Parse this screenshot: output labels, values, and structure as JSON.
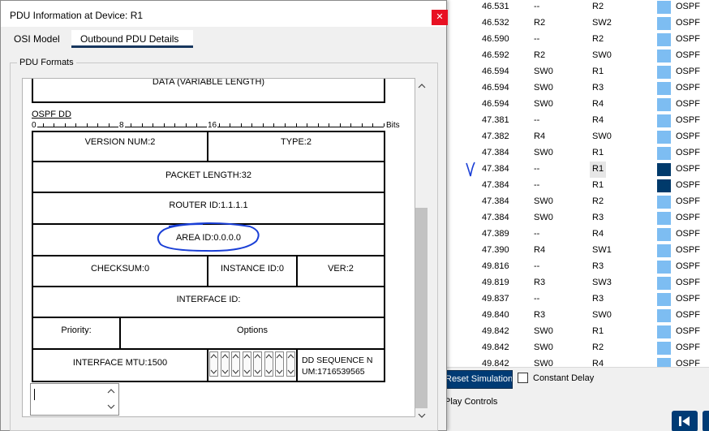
{
  "window": {
    "title": "PDU Information at Device: R1",
    "close_glyph": "✕"
  },
  "tabs": [
    {
      "label": "OSI Model"
    },
    {
      "label": "Outbound PDU Details"
    }
  ],
  "pdu_formats_label": "PDU Formats",
  "diagram": {
    "top_field": "DATA (VARIABLE LENGTH)",
    "ruler": {
      "title": "OSPF DD",
      "marks": [
        "0",
        "8",
        "16"
      ],
      "unit": "Bits"
    },
    "fields": {
      "version": "VERSION NUM:2",
      "type": "TYPE:2",
      "packet_length": "PACKET LENGTH:32",
      "router_id": "ROUTER ID:1.1.1.1",
      "area_id": "AREA ID:0.0.0.0",
      "checksum": "CHECKSUM:0",
      "instance_id": "INSTANCE ID:0",
      "ver": "VER:2",
      "interface_id": "INTERFACE ID:",
      "priority": "Priority:",
      "options": "Options",
      "interface_mtu": "INTERFACE MTU:1500",
      "dd_sequence_line1": "DD SEQUENCE N",
      "dd_sequence_line2": "UM:1716539565"
    }
  },
  "events": [
    {
      "time": "46.531",
      "last": "--",
      "at": "R2",
      "color": "#7dbdf2",
      "type": "OSPF"
    },
    {
      "time": "46.532",
      "last": "R2",
      "at": "SW2",
      "color": "#7dbdf2",
      "type": "OSPF"
    },
    {
      "time": "46.590",
      "last": "--",
      "at": "R2",
      "color": "#7dbdf2",
      "type": "OSPF"
    },
    {
      "time": "46.592",
      "last": "R2",
      "at": "SW0",
      "color": "#7dbdf2",
      "type": "OSPF"
    },
    {
      "time": "46.594",
      "last": "SW0",
      "at": "R1",
      "color": "#7dbdf2",
      "type": "OSPF"
    },
    {
      "time": "46.594",
      "last": "SW0",
      "at": "R3",
      "color": "#7dbdf2",
      "type": "OSPF"
    },
    {
      "time": "46.594",
      "last": "SW0",
      "at": "R4",
      "color": "#7dbdf2",
      "type": "OSPF"
    },
    {
      "time": "47.381",
      "last": "--",
      "at": "R4",
      "color": "#7dbdf2",
      "type": "OSPF"
    },
    {
      "time": "47.382",
      "last": "R4",
      "at": "SW0",
      "color": "#7dbdf2",
      "type": "OSPF"
    },
    {
      "time": "47.384",
      "last": "SW0",
      "at": "R1",
      "color": "#7dbdf2",
      "type": "OSPF"
    },
    {
      "time": "47.384",
      "last": "--",
      "at": "R1",
      "color": "#003a6b",
      "type": "OSPF",
      "selected": true
    },
    {
      "time": "47.384",
      "last": "--",
      "at": "R1",
      "color": "#003a6b",
      "type": "OSPF"
    },
    {
      "time": "47.384",
      "last": "SW0",
      "at": "R2",
      "color": "#7dbdf2",
      "type": "OSPF"
    },
    {
      "time": "47.384",
      "last": "SW0",
      "at": "R3",
      "color": "#7dbdf2",
      "type": "OSPF"
    },
    {
      "time": "47.389",
      "last": "--",
      "at": "R4",
      "color": "#7dbdf2",
      "type": "OSPF"
    },
    {
      "time": "47.390",
      "last": "R4",
      "at": "SW1",
      "color": "#7dbdf2",
      "type": "OSPF"
    },
    {
      "time": "49.816",
      "last": "--",
      "at": "R3",
      "color": "#7dbdf2",
      "type": "OSPF"
    },
    {
      "time": "49.819",
      "last": "R3",
      "at": "SW3",
      "color": "#7dbdf2",
      "type": "OSPF"
    },
    {
      "time": "49.837",
      "last": "--",
      "at": "R3",
      "color": "#7dbdf2",
      "type": "OSPF"
    },
    {
      "time": "49.840",
      "last": "R3",
      "at": "SW0",
      "color": "#7dbdf2",
      "type": "OSPF"
    },
    {
      "time": "49.842",
      "last": "SW0",
      "at": "R1",
      "color": "#7dbdf2",
      "type": "OSPF"
    },
    {
      "time": "49.842",
      "last": "SW0",
      "at": "R2",
      "color": "#7dbdf2",
      "type": "OSPF"
    },
    {
      "time": "49.842",
      "last": "SW0",
      "at": "R4",
      "color": "#7dbdf2",
      "type": "OSPF"
    }
  ],
  "simulation": {
    "reset_label": "Reset Simulation",
    "constant_delay_label": "Constant Delay",
    "constant_delay_checked": false,
    "play_controls_label": "Play Controls"
  }
}
